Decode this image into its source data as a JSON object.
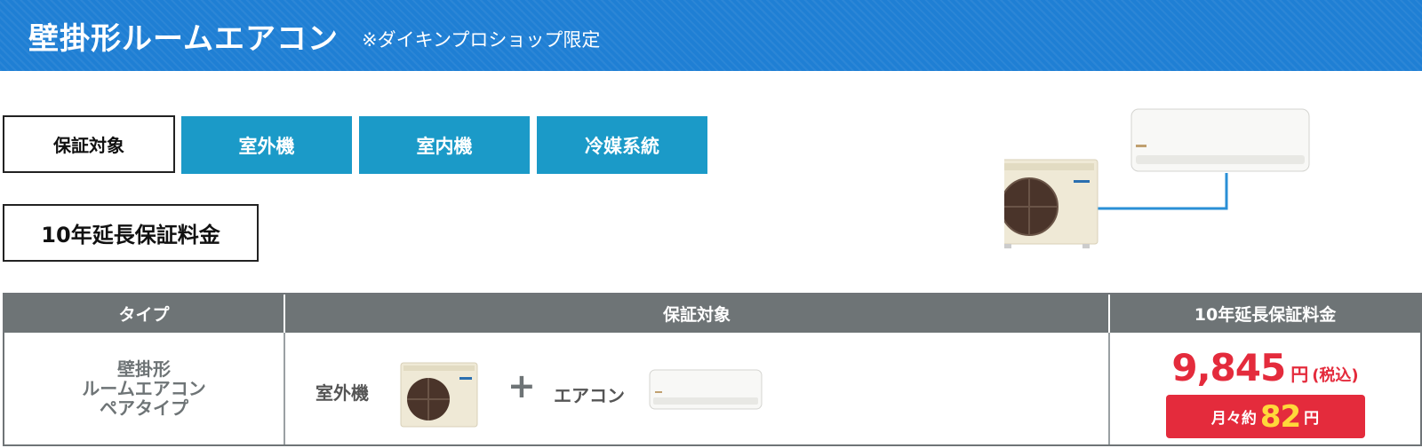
{
  "banner": {
    "title": "壁掛形ルームエアコン",
    "subtitle": "※ダイキンプロショップ限定"
  },
  "tags": {
    "target_label": "保証対象",
    "fee_label": "10年延長保証料金",
    "tabs": [
      "室外機",
      "室内機",
      "冷媒系統"
    ]
  },
  "table": {
    "headers": [
      "タイプ",
      "保証対象",
      "10年延長保証料金"
    ],
    "row": {
      "type_lines": [
        "壁掛形",
        "ルームエアコン",
        "ペアタイプ"
      ],
      "outdoor_label": "室外機",
      "plus": "+",
      "ac_label": "エアコン",
      "price": "9,845",
      "price_unit": "円",
      "price_tax": "(税込)",
      "monthly_label": "月々約",
      "monthly_value": "82",
      "monthly_unit": "円"
    }
  },
  "colors": {
    "banner": "#1f7fd4",
    "tab_blue": "#1b9ac8",
    "header_gray": "#6e7476",
    "price_red": "#e42b3c",
    "monthly_yellow": "#ffd83a"
  },
  "icons": {
    "illustration": "outdoor-unit-and-indoor-ac-illustration",
    "outdoor_unit": "outdoor-unit-icon",
    "indoor_unit": "indoor-ac-icon"
  }
}
